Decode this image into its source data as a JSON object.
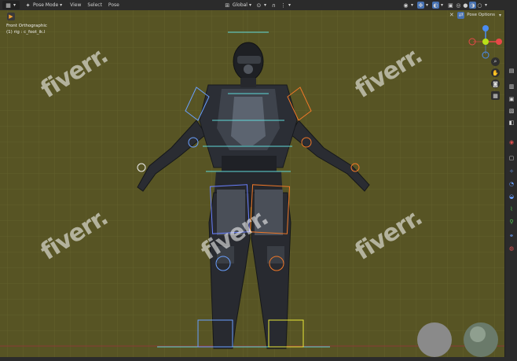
{
  "header": {
    "mode_label": "Pose Mode",
    "menus": [
      "View",
      "Select",
      "Pose"
    ],
    "transform_orientation": "Global",
    "pose_options_label": "Pose Options"
  },
  "viewport": {
    "view_name": "Front Orthographic",
    "active_object": "(1) rig : c_foot_ik.l",
    "background_color": "#575424"
  },
  "watermark": {
    "text": "fiverr."
  },
  "icons": {
    "editor_type": "view3d-icon",
    "select_box": "select-box-icon",
    "zoom": "zoom-icon",
    "pan": "hand-icon",
    "camera": "camera-icon",
    "grid": "grid-icon"
  },
  "accent": "#4772b3"
}
